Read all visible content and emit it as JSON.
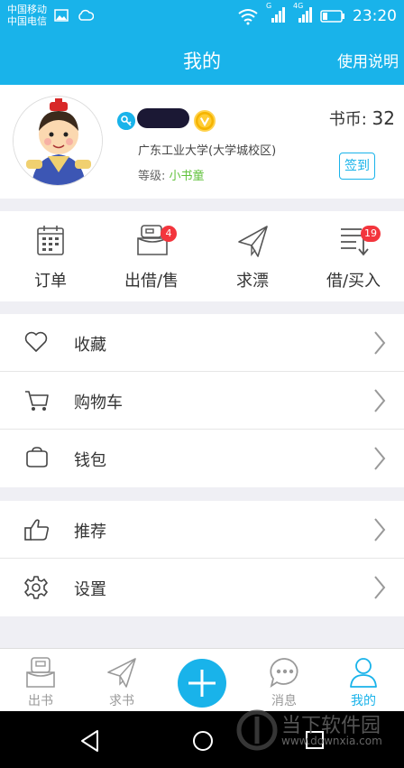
{
  "status_bar": {
    "carrier_1": "中国移动",
    "carrier_2": "中国电信",
    "network_1": "G",
    "network_2": "4G",
    "time": "23:20"
  },
  "header": {
    "title": "我的",
    "help": "使用说明"
  },
  "profile": {
    "school": "广东工业大学(大学城校区)",
    "level_label": "等级:",
    "level_value": "小书童",
    "coins_label": "书币:",
    "coins_value": "32",
    "sign_in": "签到"
  },
  "shortcuts": [
    {
      "label": "订单",
      "icon": "calendar-icon"
    },
    {
      "label": "出借/售",
      "icon": "box-icon",
      "badge": "4"
    },
    {
      "label": "求漂",
      "icon": "paper-plane-icon"
    },
    {
      "label": "借/买入",
      "icon": "list-download-icon",
      "badge": "19"
    }
  ],
  "menu_group_1": [
    {
      "label": "收藏",
      "icon": "heart-icon"
    },
    {
      "label": "购物车",
      "icon": "cart-icon"
    },
    {
      "label": "钱包",
      "icon": "wallet-icon"
    }
  ],
  "menu_group_2": [
    {
      "label": "推荐",
      "icon": "thumbs-up-icon"
    },
    {
      "label": "设置",
      "icon": "gear-icon"
    }
  ],
  "tabbar": [
    {
      "label": "出书",
      "icon": "book-upload-icon"
    },
    {
      "label": "求书",
      "icon": "paper-plane-icon"
    },
    {
      "label": "",
      "icon": "plus-icon"
    },
    {
      "label": "消息",
      "icon": "chat-bubble-icon"
    },
    {
      "label": "我的",
      "icon": "person-icon",
      "active": true
    }
  ],
  "watermark": {
    "text": "当下软件园",
    "url": "www.downxia.com"
  },
  "colors": {
    "primary": "#19b3ea",
    "badge": "#f3353d",
    "level": "#61c23c"
  }
}
